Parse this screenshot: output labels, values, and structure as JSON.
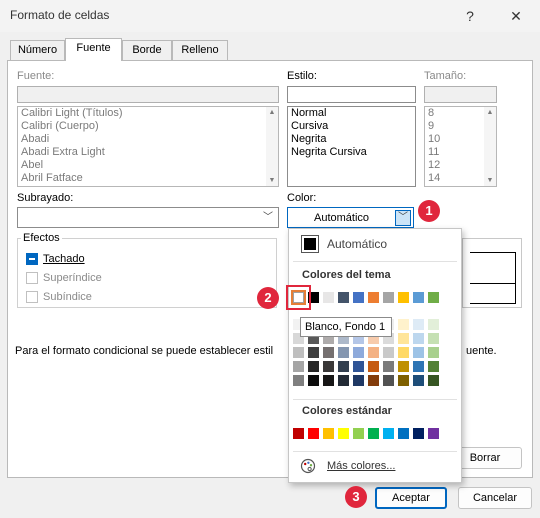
{
  "window": {
    "title": "Formato de celdas",
    "help": "?",
    "close": "✕"
  },
  "tabs": [
    {
      "label": "Número",
      "active": false
    },
    {
      "label": "Fuente",
      "active": true
    },
    {
      "label": "Borde",
      "active": false
    },
    {
      "label": "Relleno",
      "active": false
    }
  ],
  "font": {
    "label": "Fuente:",
    "value": "",
    "items": [
      "Calibri Light (Títulos)",
      "Calibri (Cuerpo)",
      "Abadi",
      "Abadi Extra Light",
      "Abel",
      "Abril Fatface"
    ]
  },
  "style": {
    "label": "Estilo:",
    "value": "",
    "items": [
      "Normal",
      "Cursiva",
      "Negrita",
      "Negrita Cursiva"
    ]
  },
  "size": {
    "label": "Tamaño:",
    "value": "",
    "items": [
      "8",
      "9",
      "10",
      "11",
      "12",
      "14"
    ]
  },
  "underline": {
    "label": "Subrayado:",
    "value": ""
  },
  "color": {
    "label": "Color:",
    "value": "Automático"
  },
  "effects": {
    "title": "Efectos",
    "items": [
      {
        "label": "Tachado",
        "checked": true,
        "enabled": true
      },
      {
        "label": "Superíndice",
        "checked": false,
        "enabled": false
      },
      {
        "label": "Subíndice",
        "checked": false,
        "enabled": false
      }
    ]
  },
  "note": {
    "left": "Para el formato condicional se puede establecer estil",
    "right": "uente."
  },
  "buttons": {
    "clear": "Borrar",
    "ok": "Aceptar",
    "cancel": "Cancelar"
  },
  "color_menu": {
    "automatic": "Automático",
    "theme_header": "Colores del tema",
    "standard_header": "Colores estándar",
    "more": "Más colores...",
    "tooltip": "Blanco, Fondo 1",
    "theme_top": [
      "#ffffff",
      "#000000",
      "#e7e6e6",
      "#44546a",
      "#4472c4",
      "#ed7d31",
      "#a5a5a5",
      "#ffc000",
      "#5b9bd5",
      "#70ad47"
    ],
    "theme_shades": [
      [
        "#f2f2f2",
        "#7f7f7f",
        "#d0cece",
        "#d6dce4",
        "#d9e2f3",
        "#fbe5d5",
        "#ededed",
        "#fff2cc",
        "#deebf6",
        "#e2efd9"
      ],
      [
        "#d8d8d8",
        "#595959",
        "#aeabab",
        "#adb9ca",
        "#b4c6e7",
        "#f7cbac",
        "#dbdbdb",
        "#ffe599",
        "#bdd7ee",
        "#c5e0b3"
      ],
      [
        "#bfbfbf",
        "#3f3f3f",
        "#757070",
        "#8496b0",
        "#8eaadb",
        "#f4b183",
        "#c9c9c9",
        "#ffd965",
        "#9dc3e6",
        "#a8d08d"
      ],
      [
        "#a5a5a5",
        "#262626",
        "#3a3838",
        "#323f4f",
        "#2f5496",
        "#c55a11",
        "#7b7b7b",
        "#bf9000",
        "#2e75b5",
        "#538135"
      ],
      [
        "#7f7f7f",
        "#0c0c0c",
        "#171616",
        "#222a35",
        "#1f3864",
        "#833c0b",
        "#525252",
        "#7f6000",
        "#1e4e79",
        "#375623"
      ]
    ],
    "standard": [
      "#c00000",
      "#ff0000",
      "#ffc000",
      "#ffff00",
      "#92d050",
      "#00b050",
      "#00b0f0",
      "#0070c0",
      "#002060",
      "#7030a0"
    ]
  },
  "callouts": [
    "1",
    "2",
    "3"
  ]
}
